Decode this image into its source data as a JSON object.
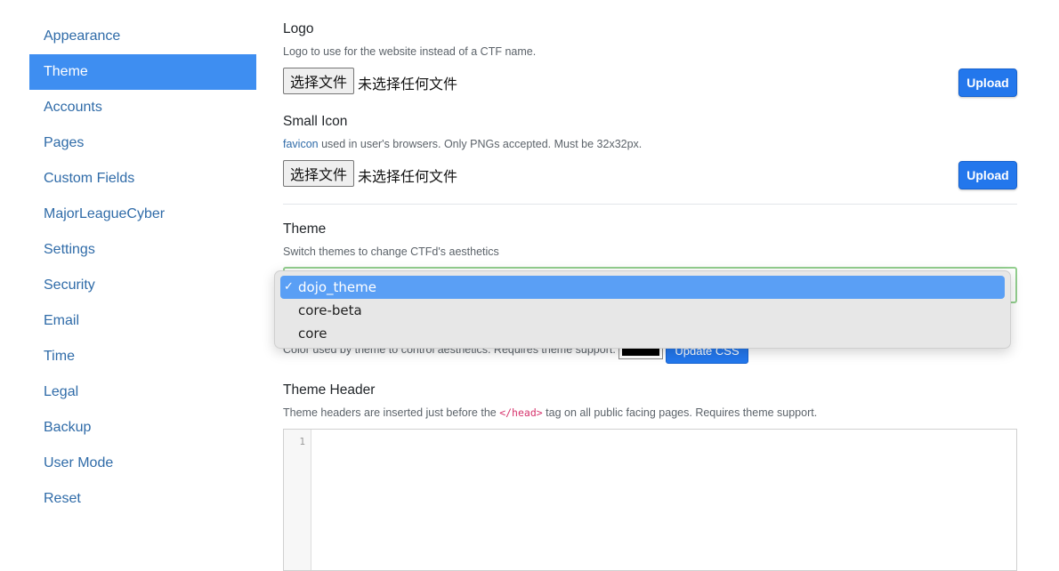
{
  "sidebar": {
    "items": [
      {
        "label": "Appearance"
      },
      {
        "label": "Theme"
      },
      {
        "label": "Accounts"
      },
      {
        "label": "Pages"
      },
      {
        "label": "Custom Fields"
      },
      {
        "label": "MajorLeagueCyber"
      },
      {
        "label": "Settings"
      },
      {
        "label": "Security"
      },
      {
        "label": "Email"
      },
      {
        "label": "Time"
      },
      {
        "label": "Legal"
      },
      {
        "label": "Backup"
      },
      {
        "label": "User Mode"
      },
      {
        "label": "Reset"
      }
    ],
    "active": "Theme"
  },
  "logo": {
    "title": "Logo",
    "help": "Logo to use for the website instead of a CTF name.",
    "file_button": "选择文件",
    "file_status": "未选择任何文件",
    "upload_label": "Upload"
  },
  "small_icon": {
    "title": "Small Icon",
    "help_link": "favicon",
    "help_rest": " used in user's browsers. Only PNGs accepted. Must be 32x32px.",
    "file_button": "选择文件",
    "file_status": "未选择任何文件",
    "upload_label": "Upload"
  },
  "theme": {
    "title": "Theme",
    "help": "Switch themes to change CTFd's aesthetics",
    "options": [
      {
        "label": "dojo_theme",
        "selected": true
      },
      {
        "label": "core-beta",
        "selected": false
      },
      {
        "label": "core",
        "selected": false
      }
    ],
    "check_glyph": "✓"
  },
  "theme_color": {
    "help": "Color used by theme to control aesthetics. Requires theme support.",
    "color": "#000000",
    "update_label": "Update CSS"
  },
  "theme_header": {
    "title": "Theme Header",
    "help_before": "Theme headers are inserted just before the ",
    "help_code": "</head>",
    "help_after": " tag on all public facing pages. Requires theme support.",
    "line_number": "1"
  },
  "colors": {
    "accent": "#3e8ef1",
    "link": "#2f6ba8",
    "button": "#2377ec",
    "select_focus": "#93cf8f"
  }
}
